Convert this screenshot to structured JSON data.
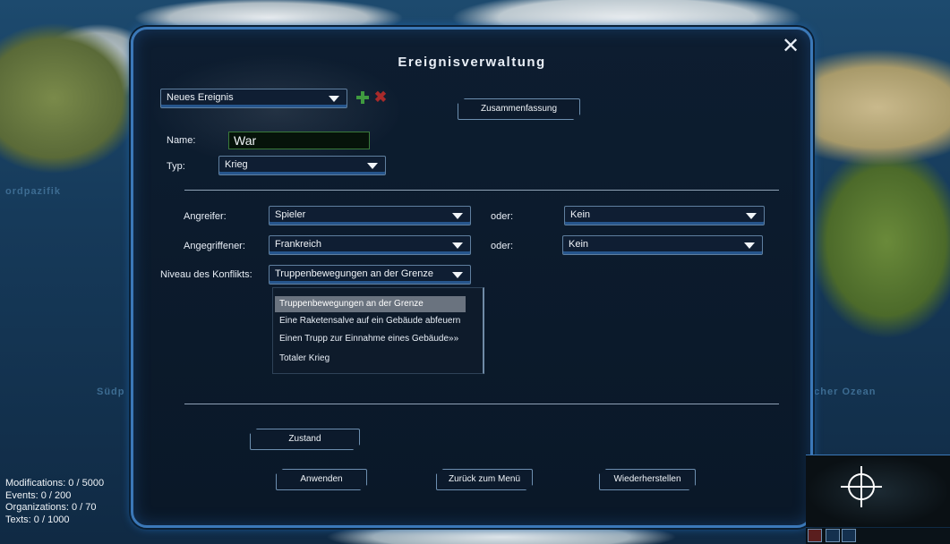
{
  "map": {
    "labels": [
      "ordpazifik",
      "Südp",
      "ischer Ozean"
    ]
  },
  "dialog": {
    "title": "Ereignisverwaltung",
    "close_icon": "close-icon",
    "event_select": {
      "value": "Neues Ereignis"
    },
    "add_icon": "plus-icon",
    "delete_icon": "delete-icon",
    "summary_button": "Zusammenfassung",
    "name_label": "Name:",
    "name_value": "War",
    "type_label": "Typ:",
    "type_value": "Krieg",
    "attacker_label": "Angreifer:",
    "attacker_value": "Spieler",
    "attacker_or_label": "oder:",
    "attacker_or_value": "Kein",
    "defender_label": "Angegriffener:",
    "defender_value": "Frankreich",
    "defender_or_label": "oder:",
    "defender_or_value": "Kein",
    "conflict_label": "Niveau des Konflikts:",
    "conflict_value": "Truppenbewegungen an der Grenze",
    "conflict_options": [
      "Truppenbewegungen an der Grenze",
      "Eine Raketensalve auf ein Gebäude abfeuern",
      "Einen Trupp zur Einnahme eines Gebäude»»",
      "Totaler Krieg"
    ],
    "state_button": "Zustand",
    "apply_button": "Anwenden",
    "back_button": "Zurück zum Menü",
    "restore_button": "Wiederherstellen"
  },
  "stats": {
    "modifications": "Modifications: 0 /  5000",
    "events": "Events: 0 /  200",
    "organizations": "Organizations: 0 /  70",
    "texts": "Texts: 0 /  1000"
  },
  "minimap": {
    "icons": [
      "crosshair-icon",
      "globe-icon",
      "chart-icon",
      "bars-icon"
    ]
  }
}
